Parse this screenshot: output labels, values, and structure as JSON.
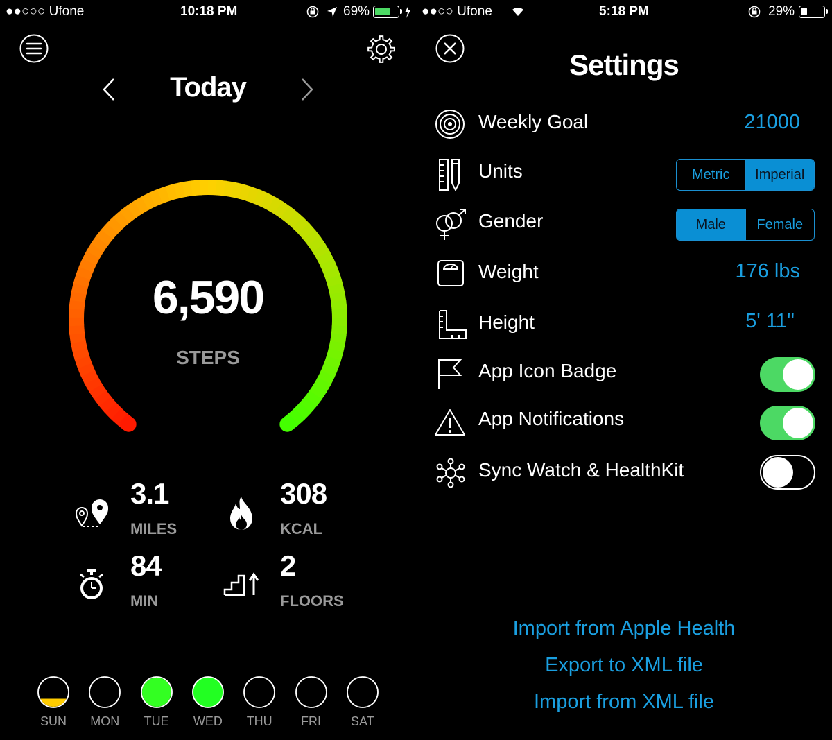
{
  "left": {
    "status": {
      "carrier": "●●○○○ Ufone",
      "time": "10:18 PM",
      "battery_pct": "69%",
      "battery_level": 0.69,
      "battery_color": "#4cd964"
    },
    "icons": {
      "menu": "menu-icon",
      "settings": "gear-icon",
      "prev": "chevron-left-icon",
      "next": "chevron-right-icon"
    },
    "header": {
      "title": "Today"
    },
    "progress": {
      "steps_value": "6,590",
      "steps_label": "STEPS",
      "gradient_colors": [
        "#ff1a00",
        "#ffd000",
        "#44ff00"
      ]
    },
    "stats": {
      "distance": {
        "value": "3.1",
        "label": "MILES",
        "icon": "map-pin-icon"
      },
      "calories": {
        "value": "308",
        "label": "KCAL",
        "icon": "flame-icon"
      },
      "time": {
        "value": "84",
        "label": "MIN",
        "icon": "stopwatch-icon"
      },
      "floors": {
        "value": "2",
        "label": "FLOORS",
        "icon": "stairs-icon"
      }
    },
    "week": [
      {
        "label": "SUN",
        "fill": 0.35,
        "color": "#ffcc00"
      },
      {
        "label": "MON",
        "fill": 0,
        "color": "#00ff00"
      },
      {
        "label": "TUE",
        "fill": 0.95,
        "color": "#33ff22"
      },
      {
        "label": "WED",
        "fill": 1,
        "color": "#22ff22"
      },
      {
        "label": "THU",
        "fill": 0,
        "color": "#00ff00"
      },
      {
        "label": "FRI",
        "fill": 0,
        "color": "#00ff00"
      },
      {
        "label": "SAT",
        "fill": 0,
        "color": "#00ff00"
      }
    ]
  },
  "right": {
    "status": {
      "carrier": "●●○○ Ufone",
      "time": "5:18 PM",
      "battery_pct": "29%",
      "battery_level": 0.29,
      "battery_color": "#ffffff"
    },
    "icons": {
      "close": "close-icon"
    },
    "title": "Settings",
    "accent_color": "#1a9fe0",
    "rows": {
      "weekly_goal": {
        "label": "Weekly Goal",
        "value": "21000",
        "icon": "target-icon"
      },
      "units": {
        "label": "Units",
        "options": [
          "Metric",
          "Imperial"
        ],
        "selected": "Imperial",
        "icon": "ruler-pencil-icon"
      },
      "gender": {
        "label": "Gender",
        "options": [
          "Male",
          "Female"
        ],
        "selected": "Male",
        "icon": "gender-icon"
      },
      "weight": {
        "label": "Weight",
        "value": "176 lbs",
        "icon": "scale-icon"
      },
      "height": {
        "label": "Height",
        "value": "5' 11''",
        "icon": "height-ruler-icon"
      },
      "app_icon_badge": {
        "label": "App Icon Badge",
        "on": true,
        "icon": "flag-icon"
      },
      "app_notifications": {
        "label": "App Notifications",
        "on": true,
        "icon": "warning-icon"
      },
      "sync": {
        "label": "Sync Watch & HealthKit",
        "on": false,
        "icon": "network-icon"
      }
    },
    "links": {
      "import_health": "Import from Apple Health",
      "export_xml": "Export to XML file",
      "import_xml": "Import from XML file"
    }
  }
}
